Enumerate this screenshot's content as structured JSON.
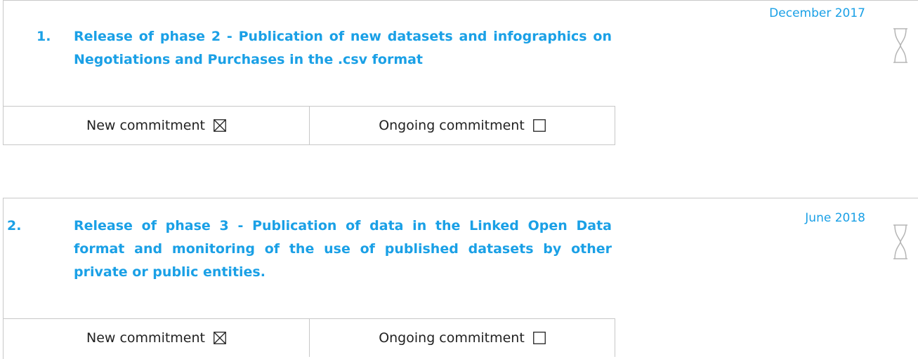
{
  "commitments": [
    {
      "number": "1.",
      "title": "Release of phase 2 - Publication of new datasets and infographics on Negotiations and Purchases in the .csv format",
      "date": "December 2017",
      "new_label": "New commitment",
      "new_checked": true,
      "ongoing_label": "Ongoing commitment",
      "ongoing_checked": false
    },
    {
      "number": "2.",
      "title": "Release of phase 3 - Publication of data in the Linked Open Data format and monitoring of the use of published datasets by other private or public entities.",
      "date": "June 2018",
      "new_label": "New commitment",
      "new_checked": true,
      "ongoing_label": "Ongoing commitment",
      "ongoing_checked": false
    }
  ],
  "colors": {
    "accent": "#1aa0e6",
    "border": "#c8c8c8",
    "text": "#222222"
  },
  "icons": {
    "status": "hourglass-icon",
    "checked": "checkbox-checked-icon",
    "unchecked": "checkbox-empty-icon"
  }
}
